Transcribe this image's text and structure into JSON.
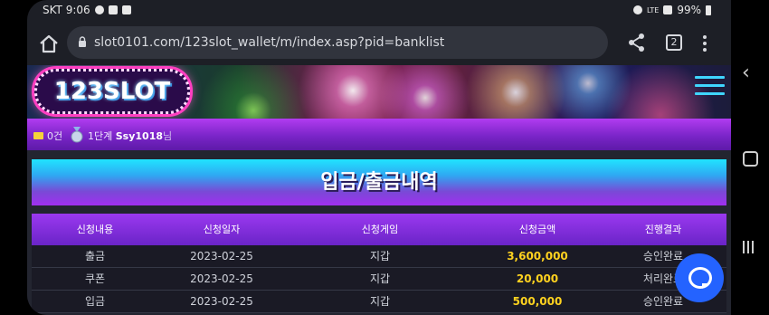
{
  "statusbar": {
    "carrier_time": "SKT 9:06",
    "network": "LTE",
    "battery": "99%"
  },
  "browser": {
    "url": "slot0101.com/123slot_wallet/m/index.asp?pid=banklist",
    "tab_count": "2",
    "icons": [
      "home-icon",
      "lock-icon",
      "share-icon",
      "tabs-icon",
      "more-vert-icon"
    ]
  },
  "site": {
    "logo_text": "123SLOT",
    "mail_count": "0건",
    "level": "1단계",
    "username": "Ssy1018",
    "user_suffix": "님",
    "page_title": "입금/출금내역"
  },
  "table": {
    "headers": [
      "신청내용",
      "신청일자",
      "신청게임",
      "신청금액",
      "진행결과"
    ],
    "rows": [
      {
        "type": "출금",
        "date": "2023-02-25",
        "game": "지갑",
        "amount": "3,600,000",
        "status": "승인완료"
      },
      {
        "type": "쿠폰",
        "date": "2023-02-25",
        "game": "지갑",
        "amount": "20,000",
        "status": "처리완료"
      },
      {
        "type": "입금",
        "date": "2023-02-25",
        "game": "지갑",
        "amount": "500,000",
        "status": "승인완료"
      }
    ]
  },
  "colors": {
    "accent_cyan": "#20e4ff",
    "accent_purple": "#9b39f0",
    "amount_yellow": "#ffd21f",
    "chat_blue": "#2463ff"
  }
}
